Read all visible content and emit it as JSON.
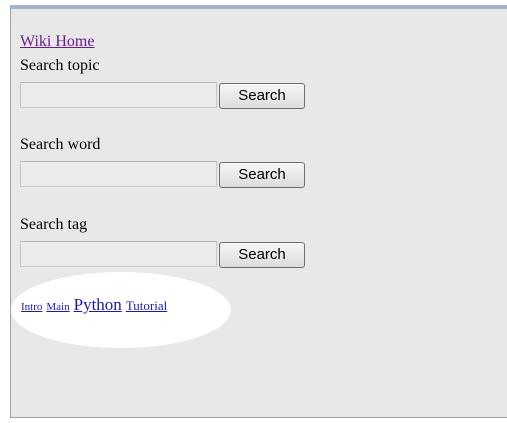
{
  "nav": {
    "wiki_home": "Wiki Home"
  },
  "search_topic": {
    "label": "Search topic",
    "value": "",
    "button": "Search"
  },
  "search_word": {
    "label": "Search word",
    "value": "",
    "button": "Search"
  },
  "search_tag": {
    "label": "Search tag",
    "value": "",
    "button": "Search"
  },
  "tag_cloud": {
    "tags": [
      {
        "label": "Intro",
        "size": "small"
      },
      {
        "label": "Main",
        "size": "small"
      },
      {
        "label": "Python",
        "size": "large"
      },
      {
        "label": "Tutorial",
        "size": "medium"
      }
    ]
  },
  "colors": {
    "visited_link": "#6a1a8a",
    "link": "#1a1aa6",
    "panel_background": "#e8e8e8"
  }
}
